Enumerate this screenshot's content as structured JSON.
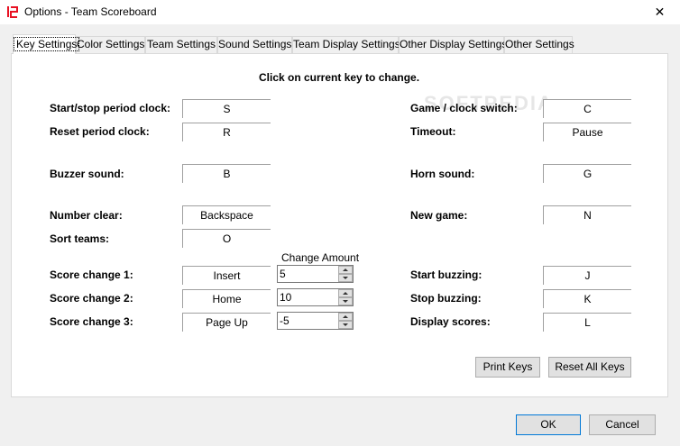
{
  "window": {
    "title": "Options - Team Scoreboard",
    "icon": "digital-12-icon",
    "close_glyph": "✕"
  },
  "tabs": [
    {
      "label": "Key Settings",
      "active": true
    },
    {
      "label": "Color Settings"
    },
    {
      "label": "Team Settings"
    },
    {
      "label": "Sound Settings"
    },
    {
      "label": "Team Display Settings"
    },
    {
      "label": "Other Display Settings"
    },
    {
      "label": "Other Settings"
    }
  ],
  "panel": {
    "heading": "Click on current key to change.",
    "watermark": "SOFTPEDIA",
    "change_amount_label": "Change Amount",
    "left_keys": [
      {
        "label": "Start/stop period clock:",
        "key": "S"
      },
      {
        "label": "Reset period clock:",
        "key": "R"
      },
      {
        "label": "Buzzer sound:",
        "key": "B"
      },
      {
        "label": "Number clear:",
        "key": "Backspace"
      },
      {
        "label": "Sort teams:",
        "key": "O"
      },
      {
        "label": "Score change 1:",
        "key": "Insert"
      },
      {
        "label": "Score change 2:",
        "key": "Home"
      },
      {
        "label": "Score change 3:",
        "key": "Page Up"
      }
    ],
    "change_amounts": [
      "5",
      "10",
      "-5"
    ],
    "right_keys": [
      {
        "label": "Game / clock switch:",
        "key": "C"
      },
      {
        "label": "Timeout:",
        "key": "Pause"
      },
      {
        "label": "Horn sound:",
        "key": "G"
      },
      {
        "label": "New game:",
        "key": "N"
      },
      {
        "label": "Start buzzing:",
        "key": "J"
      },
      {
        "label": "Stop buzzing:",
        "key": "K"
      },
      {
        "label": "Display scores:",
        "key": "L"
      }
    ],
    "print_keys": "Print Keys",
    "reset_all_keys": "Reset All Keys"
  },
  "footer": {
    "ok": "OK",
    "cancel": "Cancel"
  },
  "colors": {
    "accent": "#0078d7",
    "app_icon": "#e81123"
  }
}
